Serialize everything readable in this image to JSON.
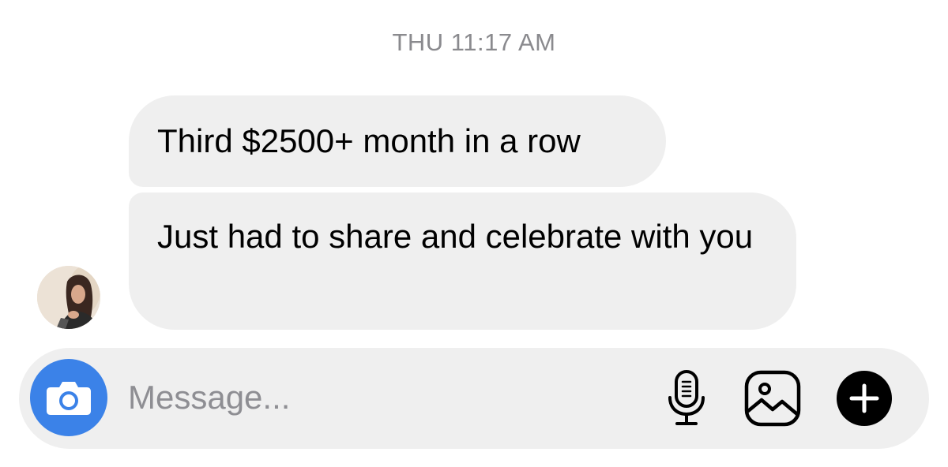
{
  "thread": {
    "timestamp": "THU 11:17 AM"
  },
  "messages": [
    {
      "text": "Third $2500+ month in a row"
    },
    {
      "text": "Just had to share and celebrate with you"
    }
  ],
  "sender": {
    "avatar_icon": "avatar-photo"
  },
  "composer": {
    "placeholder": "Message...",
    "camera_icon": "camera-icon",
    "mic_icon": "microphone-icon",
    "photo_icon": "image-icon",
    "plus_icon": "plus-icon"
  },
  "colors": {
    "bubble_bg": "#efefef",
    "composer_bg": "#efefef",
    "camera_accent": "#3b82e8",
    "timestamp_text": "#8a8a8e",
    "placeholder_text": "#8e8e93"
  }
}
